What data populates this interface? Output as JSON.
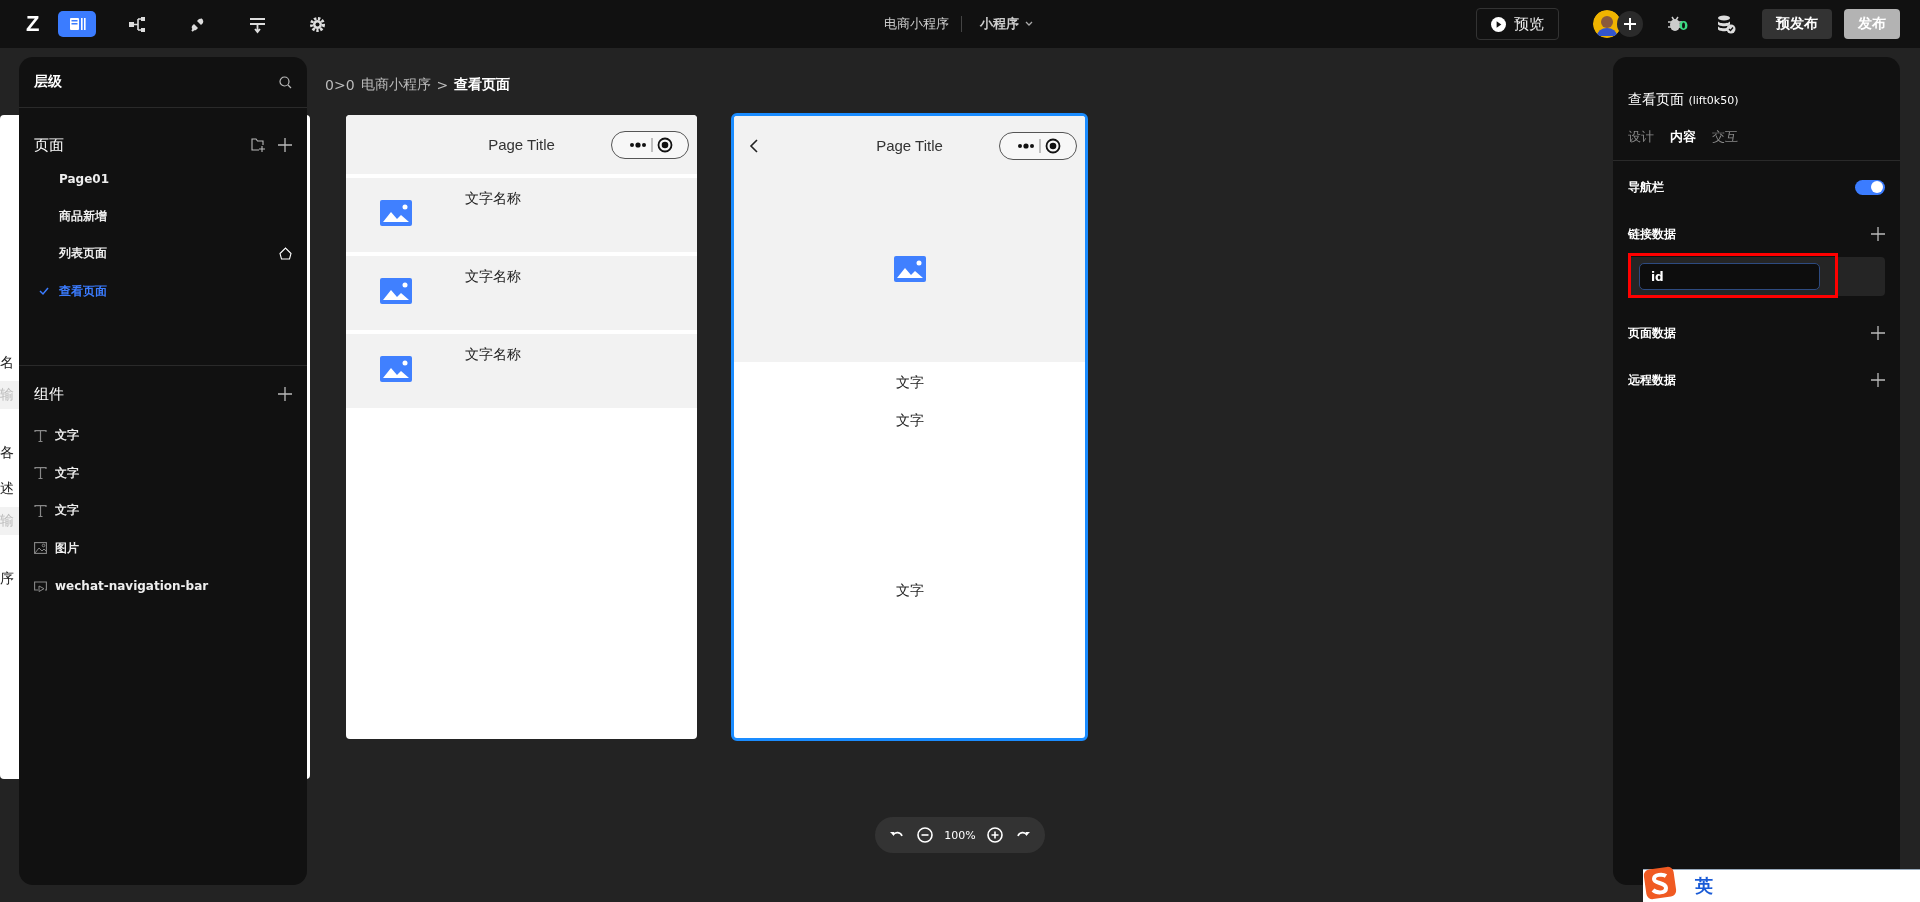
{
  "toolbar": {
    "logo": "Z",
    "tools": [
      {
        "kind": "layout",
        "selected": true
      },
      {
        "kind": "flow",
        "selected": false
      },
      {
        "kind": "plug",
        "selected": false
      },
      {
        "kind": "filter",
        "selected": false
      },
      {
        "kind": "gear",
        "selected": false
      }
    ]
  },
  "project": {
    "name": "电商小程序",
    "type": "小程序"
  },
  "preview_button": "预览",
  "bug_count": "0",
  "actions": [
    {
      "label": "预发布",
      "kind": "secondary"
    },
    {
      "label": "发布",
      "kind": "primary"
    }
  ],
  "layers_panel": {
    "title": "层级",
    "pages_title": "页面",
    "pages": [
      {
        "label": "Page01",
        "selected": false,
        "home": false
      },
      {
        "label": "商品新增",
        "selected": false,
        "home": false
      },
      {
        "label": "列表页面",
        "selected": false,
        "home": true
      },
      {
        "label": "查看页面",
        "selected": true,
        "home": false
      }
    ],
    "components_title": "组件",
    "components": [
      {
        "label": "文字",
        "kind": "text"
      },
      {
        "label": "文字",
        "kind": "text"
      },
      {
        "label": "文字",
        "kind": "text"
      },
      {
        "label": "图片",
        "kind": "image"
      },
      {
        "label": "wechat-navigation-bar",
        "kind": "navbar"
      }
    ]
  },
  "hidden_phone": {
    "rows": [
      {
        "text": "名",
        "kind": "label"
      },
      {
        "text": "输",
        "kind": "placeholder"
      },
      {
        "text": "各",
        "kind": "label"
      },
      {
        "text": "述",
        "kind": "label"
      },
      {
        "text": "输",
        "kind": "placeholder"
      },
      {
        "text": "序",
        "kind": "label"
      }
    ]
  },
  "breadcrumb": {
    "prefix": "0>0",
    "path": "电商小程序",
    "separator": ">",
    "current": "查看页面"
  },
  "phones": [
    {
      "kind": "list",
      "nav_title": "Page Title",
      "back": false,
      "selected": false,
      "rows": [
        "文字名称",
        "文字名称",
        "文字名称"
      ]
    },
    {
      "kind": "detail",
      "nav_title": "Page Title",
      "back": true,
      "selected": true,
      "texts": [
        "文字",
        "文字",
        "文字"
      ]
    }
  ],
  "zoom": {
    "level": "100%"
  },
  "props_panel": {
    "title": "查看页面",
    "id": "(lift0k50)",
    "tabs": [
      {
        "label": "设计",
        "selected": false
      },
      {
        "label": "内容",
        "selected": true
      },
      {
        "label": "交互",
        "selected": false
      }
    ],
    "nav_bar": {
      "label": "导航栏",
      "on": true
    },
    "sections": [
      {
        "title": "链接数据",
        "fields": [
          {
            "value": "id",
            "highlighted": true
          }
        ]
      },
      {
        "title": "页面数据"
      },
      {
        "title": "远程数据"
      }
    ]
  },
  "ime": {
    "mode": "英"
  }
}
